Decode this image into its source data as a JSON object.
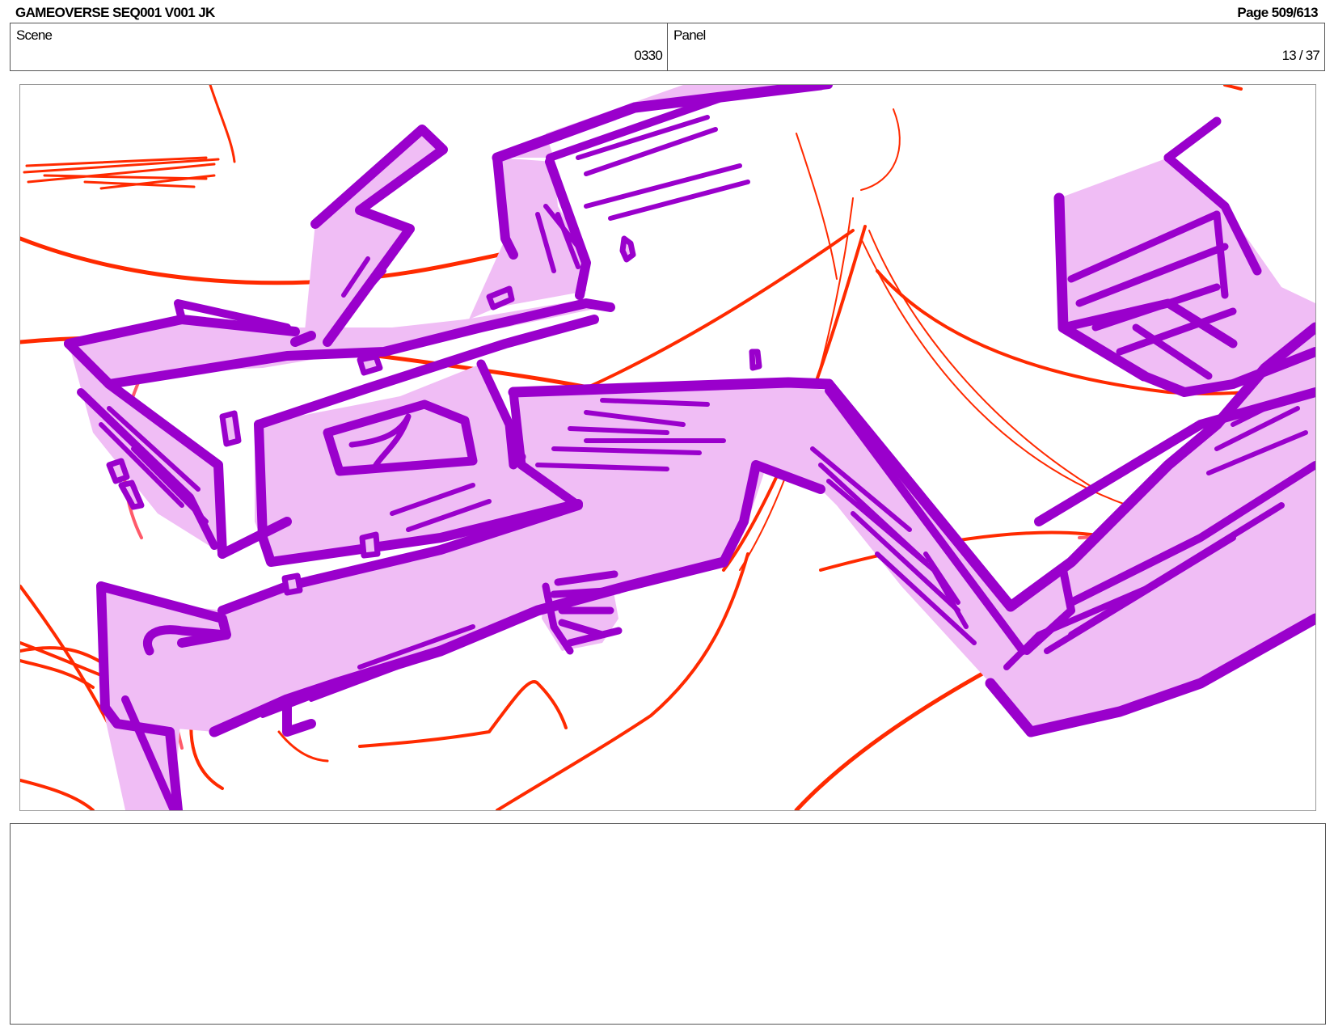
{
  "header": {
    "title": "GAMEOVERSE SEQ001 V001 JK",
    "page": "Page 509/613"
  },
  "info": {
    "scene_label": "Scene",
    "scene_value": "0330",
    "panel_label": "Panel",
    "panel_value": "13 / 37"
  },
  "artwork": {
    "description_colors": {
      "rough_lines": "#ff2a00",
      "rough_lines_light": "#ff5a6a",
      "outline": "#9a00cc",
      "fill": "#f0bdf5"
    }
  },
  "notes": {
    "text": ""
  }
}
